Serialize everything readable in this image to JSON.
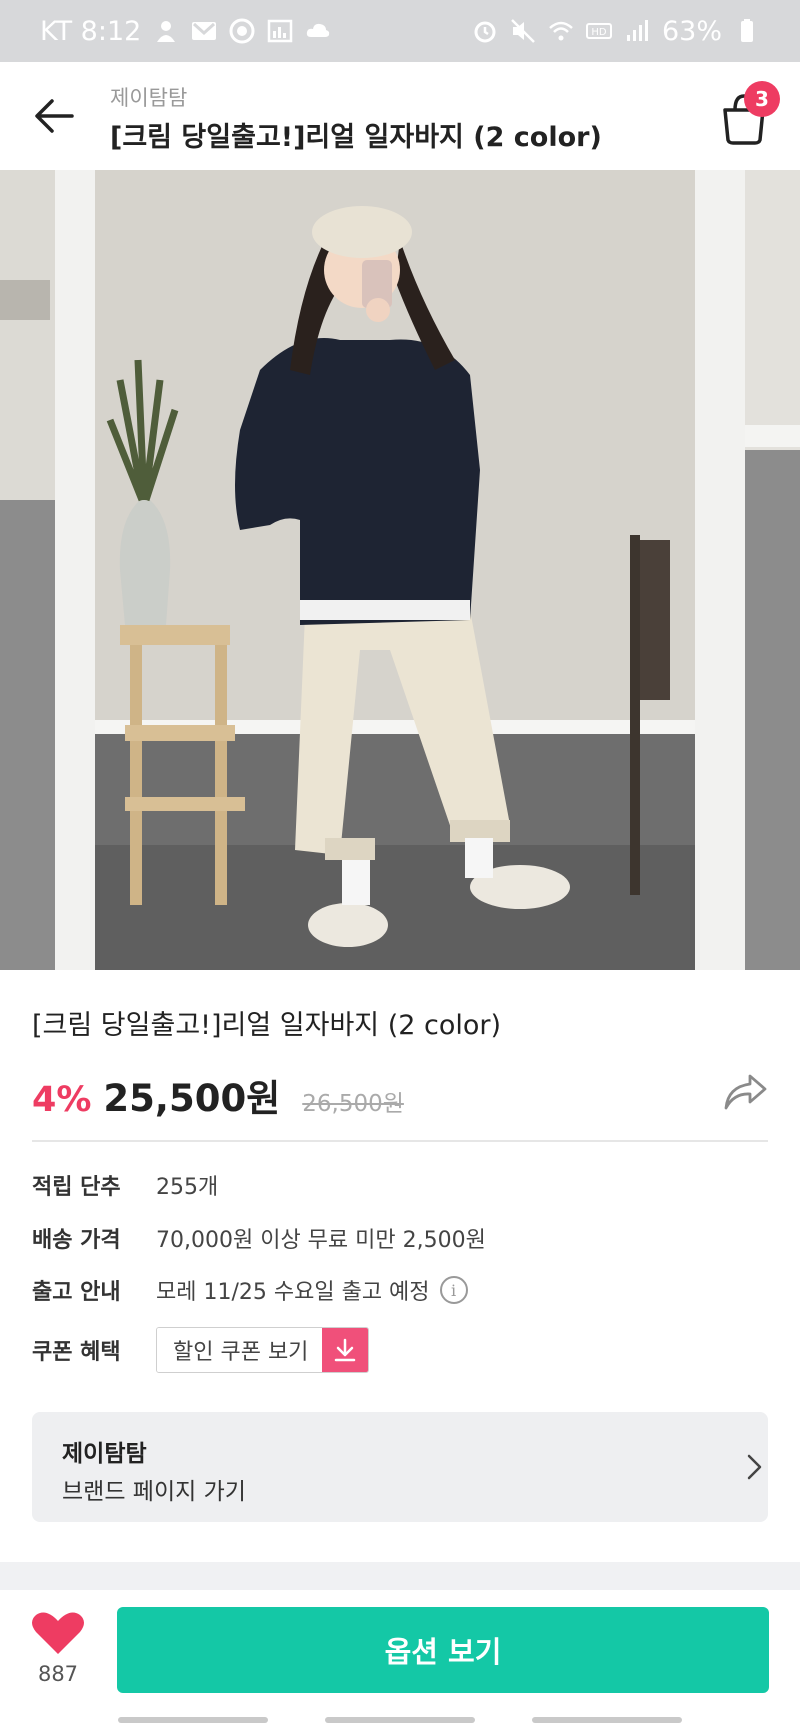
{
  "status_bar": {
    "carrier_time": "KT 8:12",
    "battery": "63%",
    "left_icons": [
      "person-icon",
      "gmail-icon",
      "circle-app-icon",
      "chart-icon",
      "cloud-icon"
    ],
    "right_icons": [
      "alarm-icon",
      "mute-icon",
      "wifi-icon",
      "hd-icon",
      "signal-icon",
      "battery-icon"
    ]
  },
  "header": {
    "brand": "제이탐탐",
    "title": "[크림 당일출고!]리얼 일자바지 (2 color)",
    "cart_count": "3",
    "back_icon": "arrow-left-icon",
    "cart_icon": "shopping-bag-icon"
  },
  "product": {
    "title": "[크림 당일출고!]리얼 일자바지 (2 color)",
    "discount": "4%",
    "price": "25,500원",
    "original_price": "26,500원",
    "share_icon": "share-arrow-icon"
  },
  "details": [
    {
      "label": "적립 단추",
      "value": "255개"
    },
    {
      "label": "배송 가격",
      "value": "70,000원 이상 무료 미만 2,500원"
    },
    {
      "label": "출고 안내",
      "value": "모레 11/25 수요일 출고 예정"
    },
    {
      "label": "쿠폰 혜택",
      "value": "할인 쿠폰 보기"
    }
  ],
  "info_icon_glyph": "i",
  "brand_card": {
    "name": "제이탐탐",
    "link": "브랜드 페이지 가기"
  },
  "bottom": {
    "like_count": "887",
    "option_button": "옵션 보기"
  },
  "colors": {
    "accent_pink": "#ee3c62",
    "coupon_pink": "#f0507a",
    "primary_teal": "#14c8a6"
  }
}
